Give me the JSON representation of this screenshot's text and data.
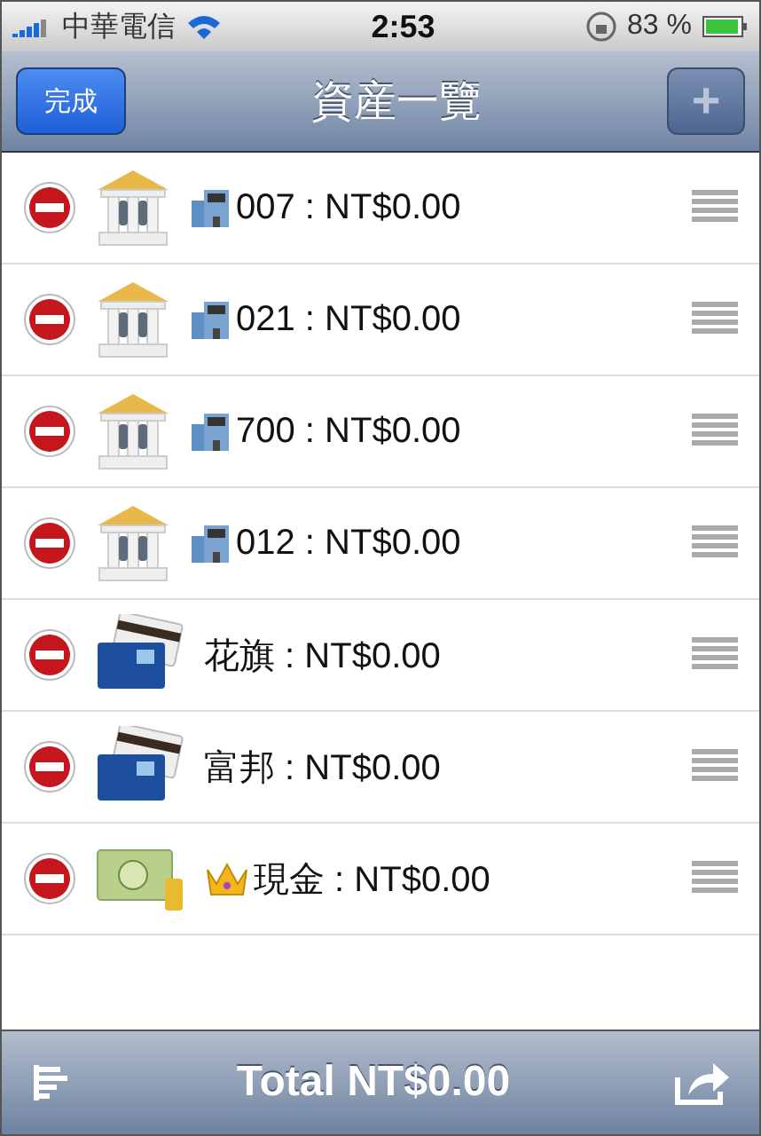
{
  "status_bar": {
    "carrier": "中華電信",
    "time": "2:53",
    "battery": "83 %"
  },
  "nav_bar": {
    "done_button": "完成",
    "title": "資産一覽",
    "add_button": "+"
  },
  "rows": [
    {
      "kind": "bank",
      "badge": {
        "kind": "building"
      },
      "label": "007 : NT$0.00"
    },
    {
      "kind": "bank",
      "badge": {
        "kind": "building"
      },
      "label": "021 : NT$0.00"
    },
    {
      "kind": "bank",
      "badge": {
        "kind": "building"
      },
      "label": "700 : NT$0.00"
    },
    {
      "kind": "bank",
      "badge": {
        "kind": "building"
      },
      "label": "012 : NT$0.00"
    },
    {
      "kind": "card",
      "label": "花旗 : NT$0.00"
    },
    {
      "kind": "card",
      "label": "富邦 : NT$0.00"
    },
    {
      "kind": "cash",
      "badge": {
        "kind": "crown"
      },
      "label": "現金 : NT$0.00"
    }
  ],
  "toolbar": {
    "total": "Total NT$0.00"
  }
}
